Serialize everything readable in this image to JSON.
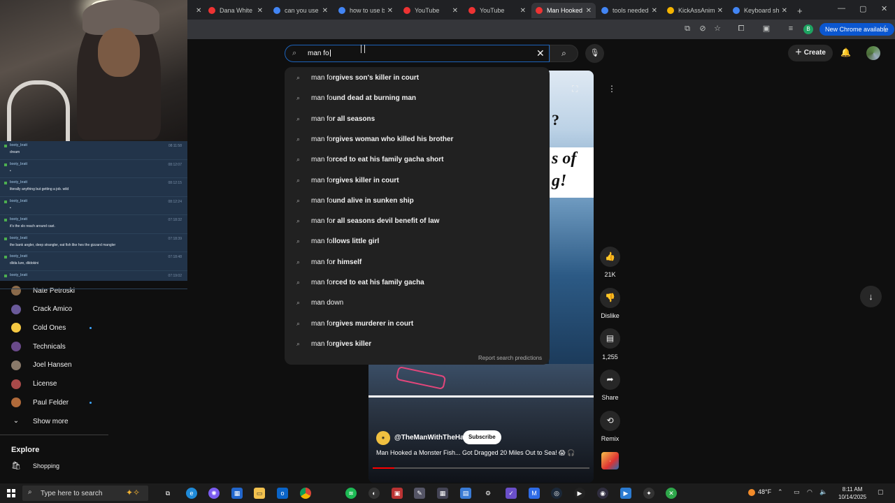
{
  "browser": {
    "tabs": [
      {
        "label": "",
        "color": "#e33"
      },
      {
        "label": "Dana White",
        "color": "#e33"
      },
      {
        "label": "can you use",
        "color": "#4285f4"
      },
      {
        "label": "how to use b",
        "color": "#4285f4"
      },
      {
        "label": "YouTube",
        "color": "#e33"
      },
      {
        "label": "YouTube",
        "color": "#e33"
      },
      {
        "label": "Man Hooked",
        "color": "#e33",
        "active": true
      },
      {
        "label": "tools needed",
        "color": "#4285f4"
      },
      {
        "label": "KickAssAnim",
        "color": "#f5b400"
      },
      {
        "label": "Keyboard sh",
        "color": "#4285f4"
      }
    ],
    "new_tab": "+",
    "profile_initial": "B",
    "new_chrome": "New Chrome available"
  },
  "stream_chat": {
    "messages": [
      {
        "user": "booty_bratt",
        "time": "08:11:58",
        "text": "dream"
      },
      {
        "user": "booty_bratt",
        "time": "08:12:07",
        "text": "•"
      },
      {
        "user": "booty_bratt",
        "time": "08:12:15",
        "text": "literally anything but getting a job. wild"
      },
      {
        "user": "booty_bratt",
        "time": "08:12:24",
        "text": "•"
      },
      {
        "user": "booty_bratt",
        "time": "07:18:32",
        "text": "it's the slo reach around cast."
      },
      {
        "user": "booty_bratt",
        "time": "07:18:39",
        "text": "the bank angler, deep strangler, eat fish like hes the gizzard mangler"
      },
      {
        "user": "booty_bratt",
        "time": "07:18:48",
        "text": "dilda lure, dildokini"
      },
      {
        "user": "booty_bratt",
        "time": "07:19:02",
        "text": ""
      }
    ]
  },
  "sidebar": {
    "subscriptions": [
      {
        "name": "Nate Petroski",
        "color": "#8a6a4a",
        "live": false
      },
      {
        "name": "Crack Amico",
        "color": "#6a5a9a",
        "live": false
      },
      {
        "name": "Cold Ones",
        "color": "#f5c842",
        "live": true
      },
      {
        "name": "Technicals",
        "color": "#6a4a8a",
        "live": false
      },
      {
        "name": "Joel Hansen",
        "color": "#8a7a6a",
        "live": false
      },
      {
        "name": "License",
        "color": "#a84a4a",
        "live": false
      },
      {
        "name": "Paul Felder",
        "color": "#b06a3a",
        "live": true
      }
    ],
    "show_more": "Show more",
    "explore_heading": "Explore",
    "shopping": "Shopping"
  },
  "search": {
    "query": "man fo",
    "prefix": "man fo",
    "suggestions": [
      "man forgives son's killer in court",
      "man found dead at burning man",
      "man for all seasons",
      "man forgives woman who killed his brother",
      "man forced to eat his family gacha short",
      "man forgives killer in court",
      "man found alive in sunken ship",
      "man for all seasons devil benefit of law",
      "man follows little girl",
      "man for himself",
      "man forced to eat his family gacha",
      "man down",
      "man forgives murderer in court",
      "man forgives killer"
    ],
    "report": "Report search predictions"
  },
  "header": {
    "create": "Create"
  },
  "short": {
    "caption_fragment": "?",
    "caption_lines": [
      "s of",
      "g!"
    ],
    "channel": "@TheManWithTheHat",
    "subscribe": "Subscribe",
    "title": "Man Hooked a Monster Fish... Got Dragged 20 Miles Out to Sea! 😱 🎧",
    "progress_fraction": 0.1
  },
  "actions": {
    "like_count": "21K",
    "dislike": "Dislike",
    "comments": "1,255",
    "share": "Share",
    "remix": "Remix"
  },
  "taskbar": {
    "search_placeholder": "Type here to search",
    "weather": "48°F",
    "time": "8:11 AM",
    "date": "10/14/2025"
  }
}
